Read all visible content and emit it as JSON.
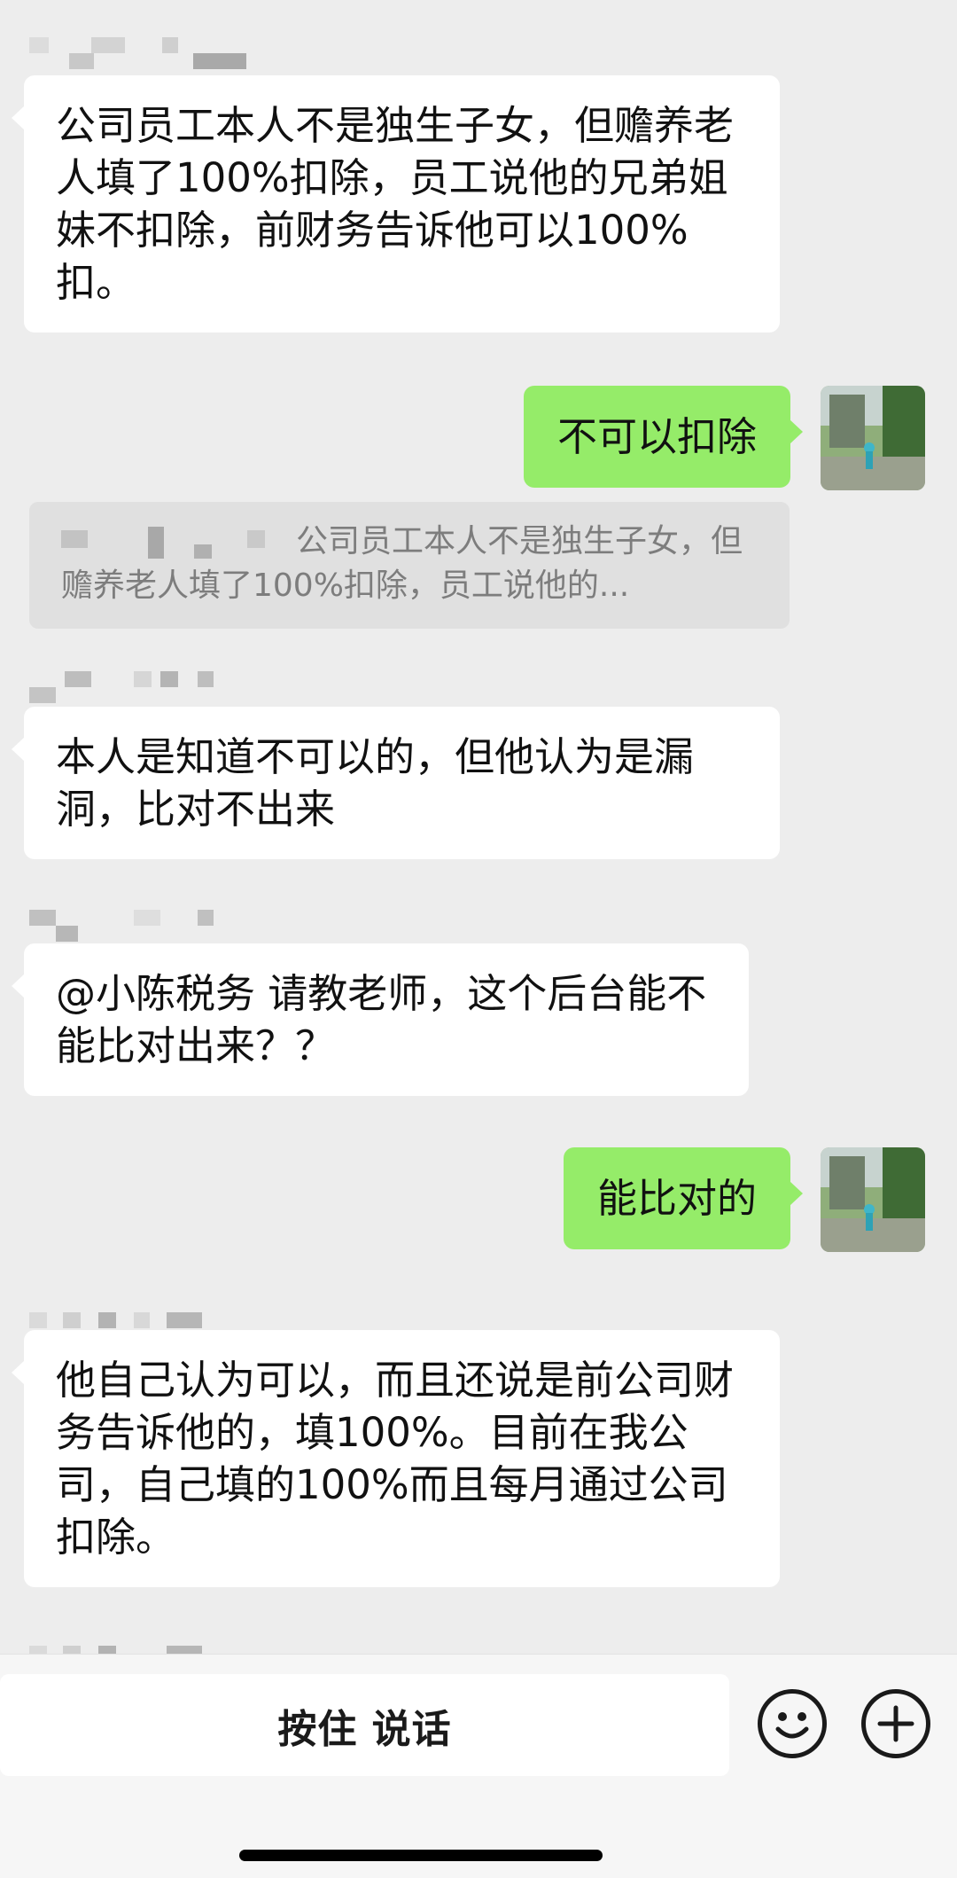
{
  "messages": [
    {
      "id": "m1",
      "direction": "incoming",
      "text": "公司员工本人不是独生子女，但赡养老人填了100%扣除，员工说他的兄弟姐妹不扣除，前财务告诉他可以100%扣。"
    },
    {
      "id": "m2",
      "direction": "outgoing",
      "text": "不可以扣除",
      "quote": "公司员工本人不是独生子女，但赡养老人填了100%扣除，员工说他的..."
    },
    {
      "id": "m3",
      "direction": "incoming",
      "text": "本人是知道不可以的，但他认为是漏洞，比对不出来"
    },
    {
      "id": "m4",
      "direction": "incoming",
      "text": "@小陈税务 请教老师，这个后台能不能比对出来？？"
    },
    {
      "id": "m5",
      "direction": "outgoing",
      "text": "能比对的"
    },
    {
      "id": "m6",
      "direction": "incoming",
      "text": "他自己认为可以，而且还说是前公司财务告诉他的，填100%。目前在我公司，自己填的100%而且每月通过公司扣除。"
    }
  ],
  "input_bar": {
    "talk_button_label": "按住 说话",
    "emoji_icon": "emoji-icon",
    "plus_icon": "plus-icon"
  },
  "colors": {
    "background": "#ededed",
    "incoming_bubble": "#ffffff",
    "outgoing_bubble": "#95ec69",
    "quote_bg": "#e0e0e0"
  }
}
